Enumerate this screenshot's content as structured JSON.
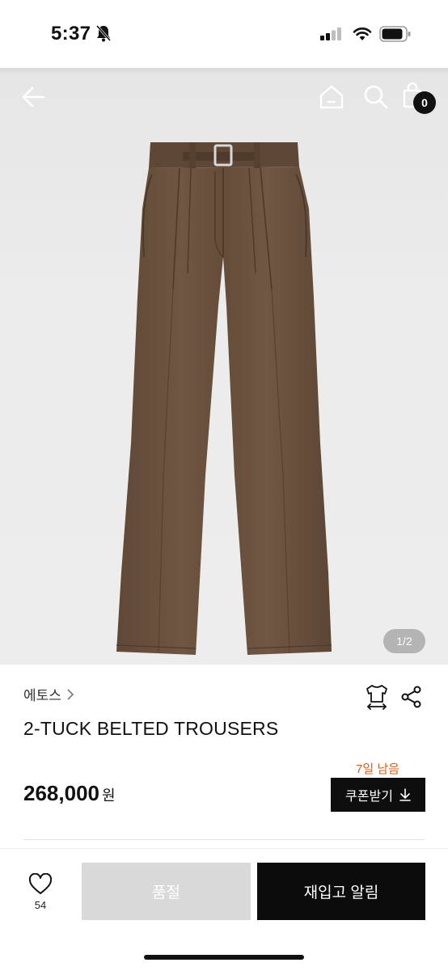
{
  "status_bar": {
    "time": "5:37"
  },
  "header": {
    "cart_count": "0"
  },
  "gallery": {
    "page_indicator": "1/2"
  },
  "product": {
    "brand": "에토스",
    "name": "2-TUCK BELTED TROUSERS",
    "price": "268,000",
    "currency": "원"
  },
  "coupon": {
    "remaining": "7일 남음",
    "button_label": "쿠폰받기"
  },
  "bottom": {
    "wish_count": "54",
    "soldout_label": "품절",
    "restock_label": "재입고 알림"
  },
  "colors": {
    "accent_orange": "#e05a10",
    "button_black": "#0c0c0c",
    "disabled_gray": "#d9d9d9",
    "trouser_brown": "#6e5540"
  },
  "icons": [
    "back-arrow-icon",
    "home-icon",
    "search-icon",
    "shopping-bag-icon",
    "size-fit-icon",
    "share-icon",
    "heart-icon",
    "download-icon",
    "bell-slash-icon",
    "signal-icon",
    "wifi-icon",
    "battery-icon",
    "chevron-right-icon"
  ]
}
